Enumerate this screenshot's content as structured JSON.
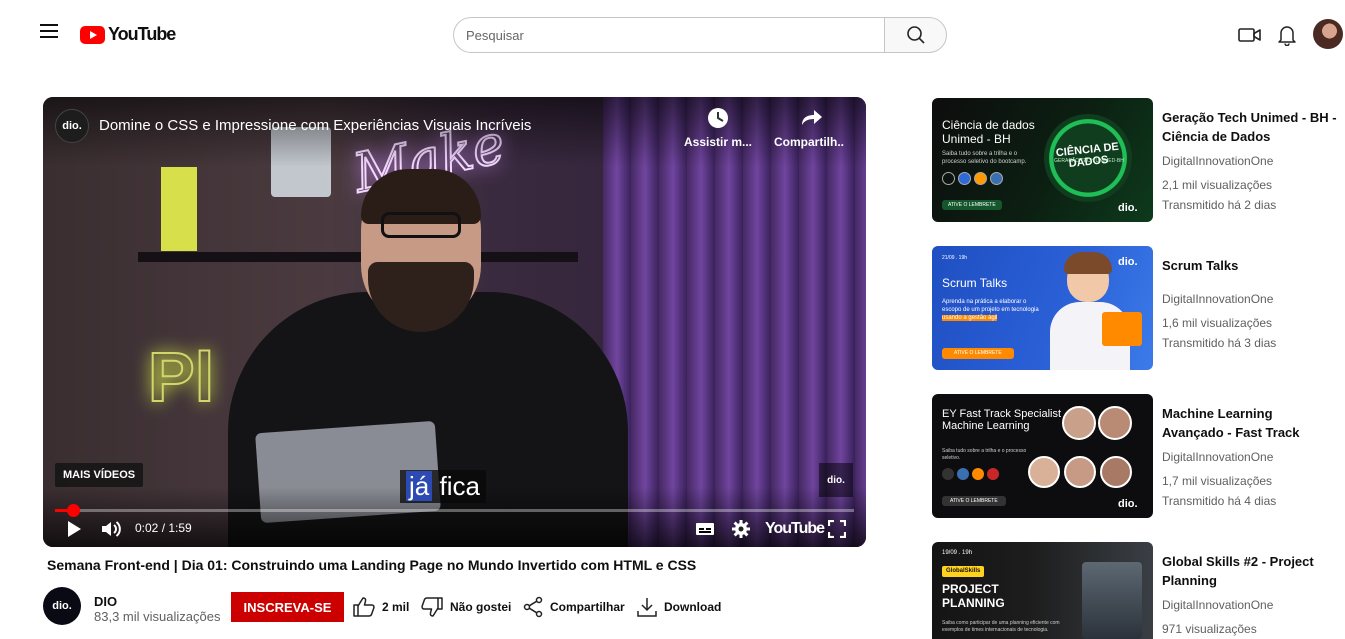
{
  "header": {
    "logo_text": "YouTube",
    "search_placeholder": "Pesquisar"
  },
  "player": {
    "video_title": "Domine o CSS e Impressione com Experiências Visuais Incríveis",
    "channel_mark": "dio.",
    "watch_later_label": "Assistir m...",
    "share_label": "Compartilh...",
    "caption_highlight": "já",
    "caption_rest": "fica",
    "more_videos": "MAIS VÍDEOS",
    "time": "0:02 / 1:59",
    "progress_fraction": 0.023,
    "brand": "YouTube"
  },
  "below": {
    "title": "Semana Front-end | Dia 01: Construindo uma Landing Page no Mundo Invertido com HTML e CSS",
    "channel_avatar_text": "dio.",
    "channel_name": "DIO",
    "channel_views": "83,3 mil visualizações",
    "subscribe_label": "INSCREVA-SE",
    "like_count": "2 mil",
    "dislike_label": "Não gostei",
    "share_label": "Compartilhar",
    "download_label": "Download"
  },
  "sidebar": {
    "items": [
      {
        "title": "Geração Tech Unimed - BH - Ciência de Dados",
        "channel": "DigitalInnovationOne",
        "views": "2,1 mil visualizações",
        "age": "Transmitido há 2 dias",
        "thumb_heading": "Ciência de dados Unimed - BH",
        "thumb_sub": "Saiba tudo sobre a trilha e o processo seletivo do bootcamp.",
        "thumb_badge": "CIÊNCIA DE DADOS",
        "thumb_badge_sub": "GERAÇÃO TECH UNIMED-BH",
        "thumb_button": "ATIVE O LEMBRETE",
        "thumb_logo": "dio."
      },
      {
        "title": "Scrum Talks",
        "channel": "DigitalInnovationOne",
        "views": "1,6 mil visualizações",
        "age": "Transmitido há 3 dias",
        "thumb_date": "21/09 . 19h",
        "thumb_heading": "Scrum Talks",
        "thumb_sub_a": "Aprenda na prática a elaborar o escopo de um projeto em tecnologia",
        "thumb_sub_b": "usando a gestão ágil",
        "thumb_button": "ATIVE O LEMBRETE",
        "thumb_logo": "dio."
      },
      {
        "title": "Machine Learning Avançado - Fast Track",
        "channel": "DigitalInnovationOne",
        "views": "1,7 mil visualizações",
        "age": "Transmitido há 4 dias",
        "thumb_heading": "EY Fast Track Specialist Machine Learning",
        "thumb_sub": "Saiba tudo sobre a trilha e o processo seletivo.",
        "thumb_button": "ATIVE O LEMBRETE",
        "thumb_logo": "dio."
      },
      {
        "title": "Global Skills #2 - Project Planning",
        "channel": "DigitalInnovationOne",
        "views": "971 visualizações",
        "thumb_date": "19/09 . 19h",
        "thumb_tag": "GlobalSkills",
        "thumb_heading": "PROJECT PLANNING",
        "thumb_sub": "Saiba como participar de uma planning eficiente com exemplos de times internacionais de tecnologia."
      }
    ]
  },
  "colors": {
    "youtube_red": "#ff0000",
    "subscribe_red": "#cc0000",
    "progress_red": "#ff0000",
    "dio_green": "#13a84a",
    "dio_blue": "#1f4fc2",
    "dio_orange": "#ff8a00"
  },
  "icons": [
    "menu-icon",
    "youtube-logo-icon",
    "search-icon",
    "video-camera-icon",
    "bell-icon",
    "clock-icon",
    "share-arrow-icon",
    "play-icon",
    "volume-icon",
    "subtitles-icon",
    "settings-gear-icon",
    "fullscreen-icon",
    "thumbs-up-icon",
    "thumbs-down-icon",
    "share-icon",
    "download-icon"
  ]
}
